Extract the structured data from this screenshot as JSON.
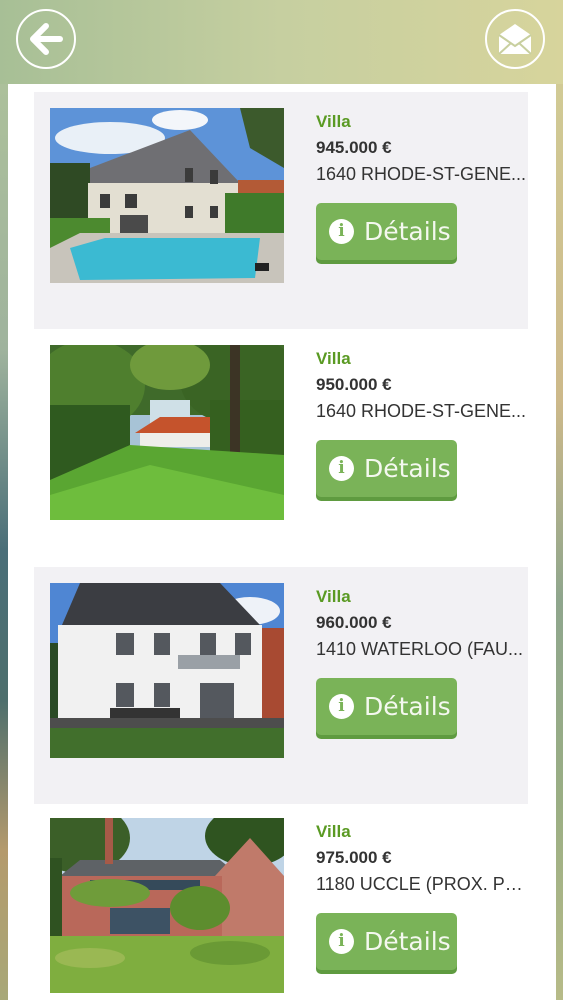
{
  "header": {
    "back_icon": "arrow-left-icon",
    "mail_icon": "envelope-icon"
  },
  "listings": [
    {
      "type": "Villa",
      "price": "945.000 €",
      "address": "1640 RHODE-ST-GENE...",
      "details_label": "Détails",
      "photo": "villa with swimming pool"
    },
    {
      "type": "Villa",
      "price": "950.000 €",
      "address": "1640 RHODE-ST-GENE...",
      "details_label": "Détails",
      "photo": "garden with trees and distant house"
    },
    {
      "type": "Villa",
      "price": "960.000 €",
      "address": "1410 WATERLOO (FAU...",
      "details_label": "Détails",
      "photo": "white house with dark roof"
    },
    {
      "type": "Villa",
      "price": "975.000 €",
      "address": "1180 UCCLE (PROX. PE...",
      "details_label": "Détails",
      "photo": "brick house with ivy"
    }
  ],
  "colors": {
    "accent_green": "#5a9a23",
    "button_green": "#7ab358",
    "card_bg": "#f2f1f4"
  }
}
